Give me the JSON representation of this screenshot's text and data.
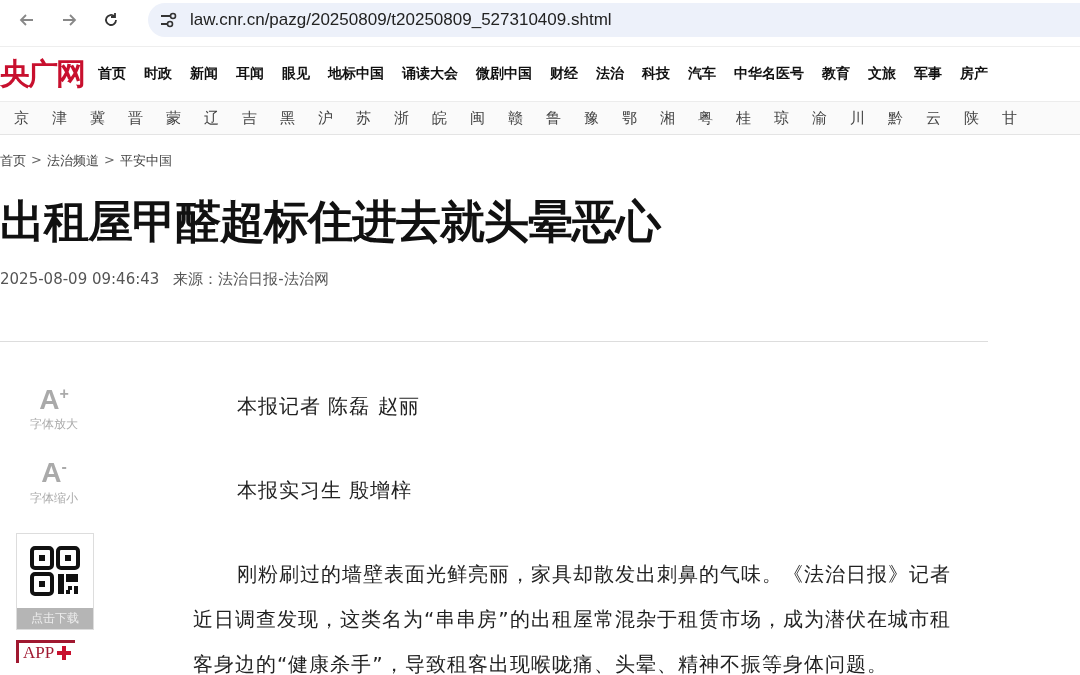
{
  "browser": {
    "url": "law.cnr.cn/pazg/20250809/t20250809_527310409.shtml"
  },
  "site": {
    "logo": "央广网",
    "nav": [
      "首页",
      "时政",
      "新闻",
      "耳闻",
      "眼见",
      "地标中国",
      "诵读大会",
      "微剧中国",
      "财经",
      "法治",
      "科技",
      "汽车",
      "中华名医号",
      "教育",
      "文旅",
      "军事",
      "房产"
    ],
    "regions": [
      "京",
      "津",
      "冀",
      "晋",
      "蒙",
      "辽",
      "吉",
      "黑",
      "沪",
      "苏",
      "浙",
      "皖",
      "闽",
      "赣",
      "鲁",
      "豫",
      "鄂",
      "湘",
      "粤",
      "桂",
      "琼",
      "渝",
      "川",
      "黔",
      "云",
      "陕",
      "甘"
    ]
  },
  "breadcrumb": {
    "separator": ">",
    "items": [
      "首页",
      "法治频道",
      "平安中国"
    ]
  },
  "article": {
    "title": "出租屋甲醛超标住进去就头晕恶心",
    "date": "2025-08-09 09:46:43",
    "source": "来源：法治日报-法治网",
    "paragraphs": [
      {
        "kind": "byline",
        "text": "本报记者 陈磊 赵丽"
      },
      {
        "kind": "byline",
        "text": "本报实习生 殷增梓"
      },
      {
        "kind": "body",
        "text": "刚粉刷过的墙壁表面光鲜亮丽，家具却散发出刺鼻的气味。《法治日报》记者近日调查发现，这类名为“串串房”的出租屋常混杂于租赁市场，成为潜伏在城市租客身边的“健康杀手”，导致租客出现喉咙痛、头晕、精神不振等身体问题。"
      }
    ]
  },
  "tools": {
    "enlarge": {
      "symbol": "A",
      "mark": "+",
      "label": "字体放大"
    },
    "shrink": {
      "symbol": "A",
      "mark": "-",
      "label": "字体缩小"
    },
    "download": "点击下载",
    "app": "APP"
  }
}
